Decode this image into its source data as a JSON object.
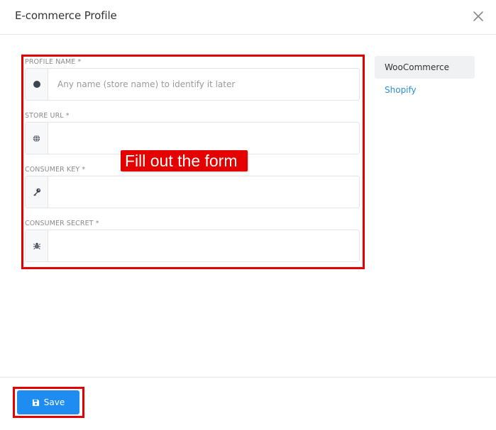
{
  "dialog": {
    "title": "E-commerce Profile"
  },
  "form": {
    "fields": [
      {
        "label": "PROFILE NAME *",
        "placeholder": "Any name (store name) to identify it later",
        "value": "",
        "icon": "circle-icon"
      },
      {
        "label": "STORE URL *",
        "placeholder": "",
        "value": "",
        "icon": "globe-icon"
      },
      {
        "label": "CONSUMER KEY *",
        "placeholder": "",
        "value": "",
        "icon": "key-icon"
      },
      {
        "label": "CONSUMER SECRET *",
        "placeholder": "",
        "value": "",
        "icon": "bug-icon"
      }
    ]
  },
  "annotation": {
    "callout_text": "Fill out the form"
  },
  "sidebar": {
    "tabs": [
      {
        "label": "WooCommerce",
        "active": true
      },
      {
        "label": "Shopify",
        "active": false
      }
    ]
  },
  "footer": {
    "save_label": "Save",
    "save_icon": "floppy-disk-icon"
  },
  "colors": {
    "primary": "#1e8cf0",
    "link": "#2b8fd6",
    "annotation_red": "#e50000"
  }
}
